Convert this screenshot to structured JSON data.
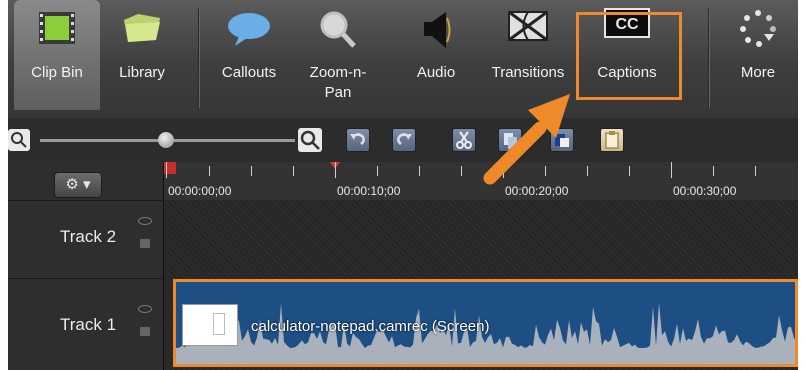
{
  "toolbar": {
    "tools": [
      {
        "id": "clipbin",
        "label": "Clip Bin",
        "icon": "film-strip-icon"
      },
      {
        "id": "library",
        "label": "Library",
        "icon": "folder-icon"
      },
      {
        "id": "callouts",
        "label": "Callouts",
        "icon": "speech-bubble-icon"
      },
      {
        "id": "zoom",
        "label_line1": "Zoom-n-",
        "label_line2": "Pan",
        "icon": "magnifier-icon"
      },
      {
        "id": "audio",
        "label": "Audio",
        "icon": "speaker-icon"
      },
      {
        "id": "transitions",
        "label": "Transitions",
        "icon": "transition-icon"
      },
      {
        "id": "captions",
        "label": "Captions",
        "icon": "cc-icon"
      },
      {
        "id": "more",
        "label": "More",
        "icon": "dots-icon"
      }
    ],
    "captions_icon_text": "CC"
  },
  "timeline": {
    "gear_symbol": "⚙ ▾",
    "ticks": [
      "00:00:00;00",
      "00:00:10;00",
      "00:00:20;00",
      "00:00:30;00"
    ]
  },
  "tracks": [
    {
      "name": "Track 2"
    },
    {
      "name": "Track 1"
    }
  ],
  "clip": {
    "name": "calculator-notepad.camrec (Screen)"
  },
  "colors": {
    "highlight": "#ef8a2b",
    "clip": "#1d4f84"
  }
}
